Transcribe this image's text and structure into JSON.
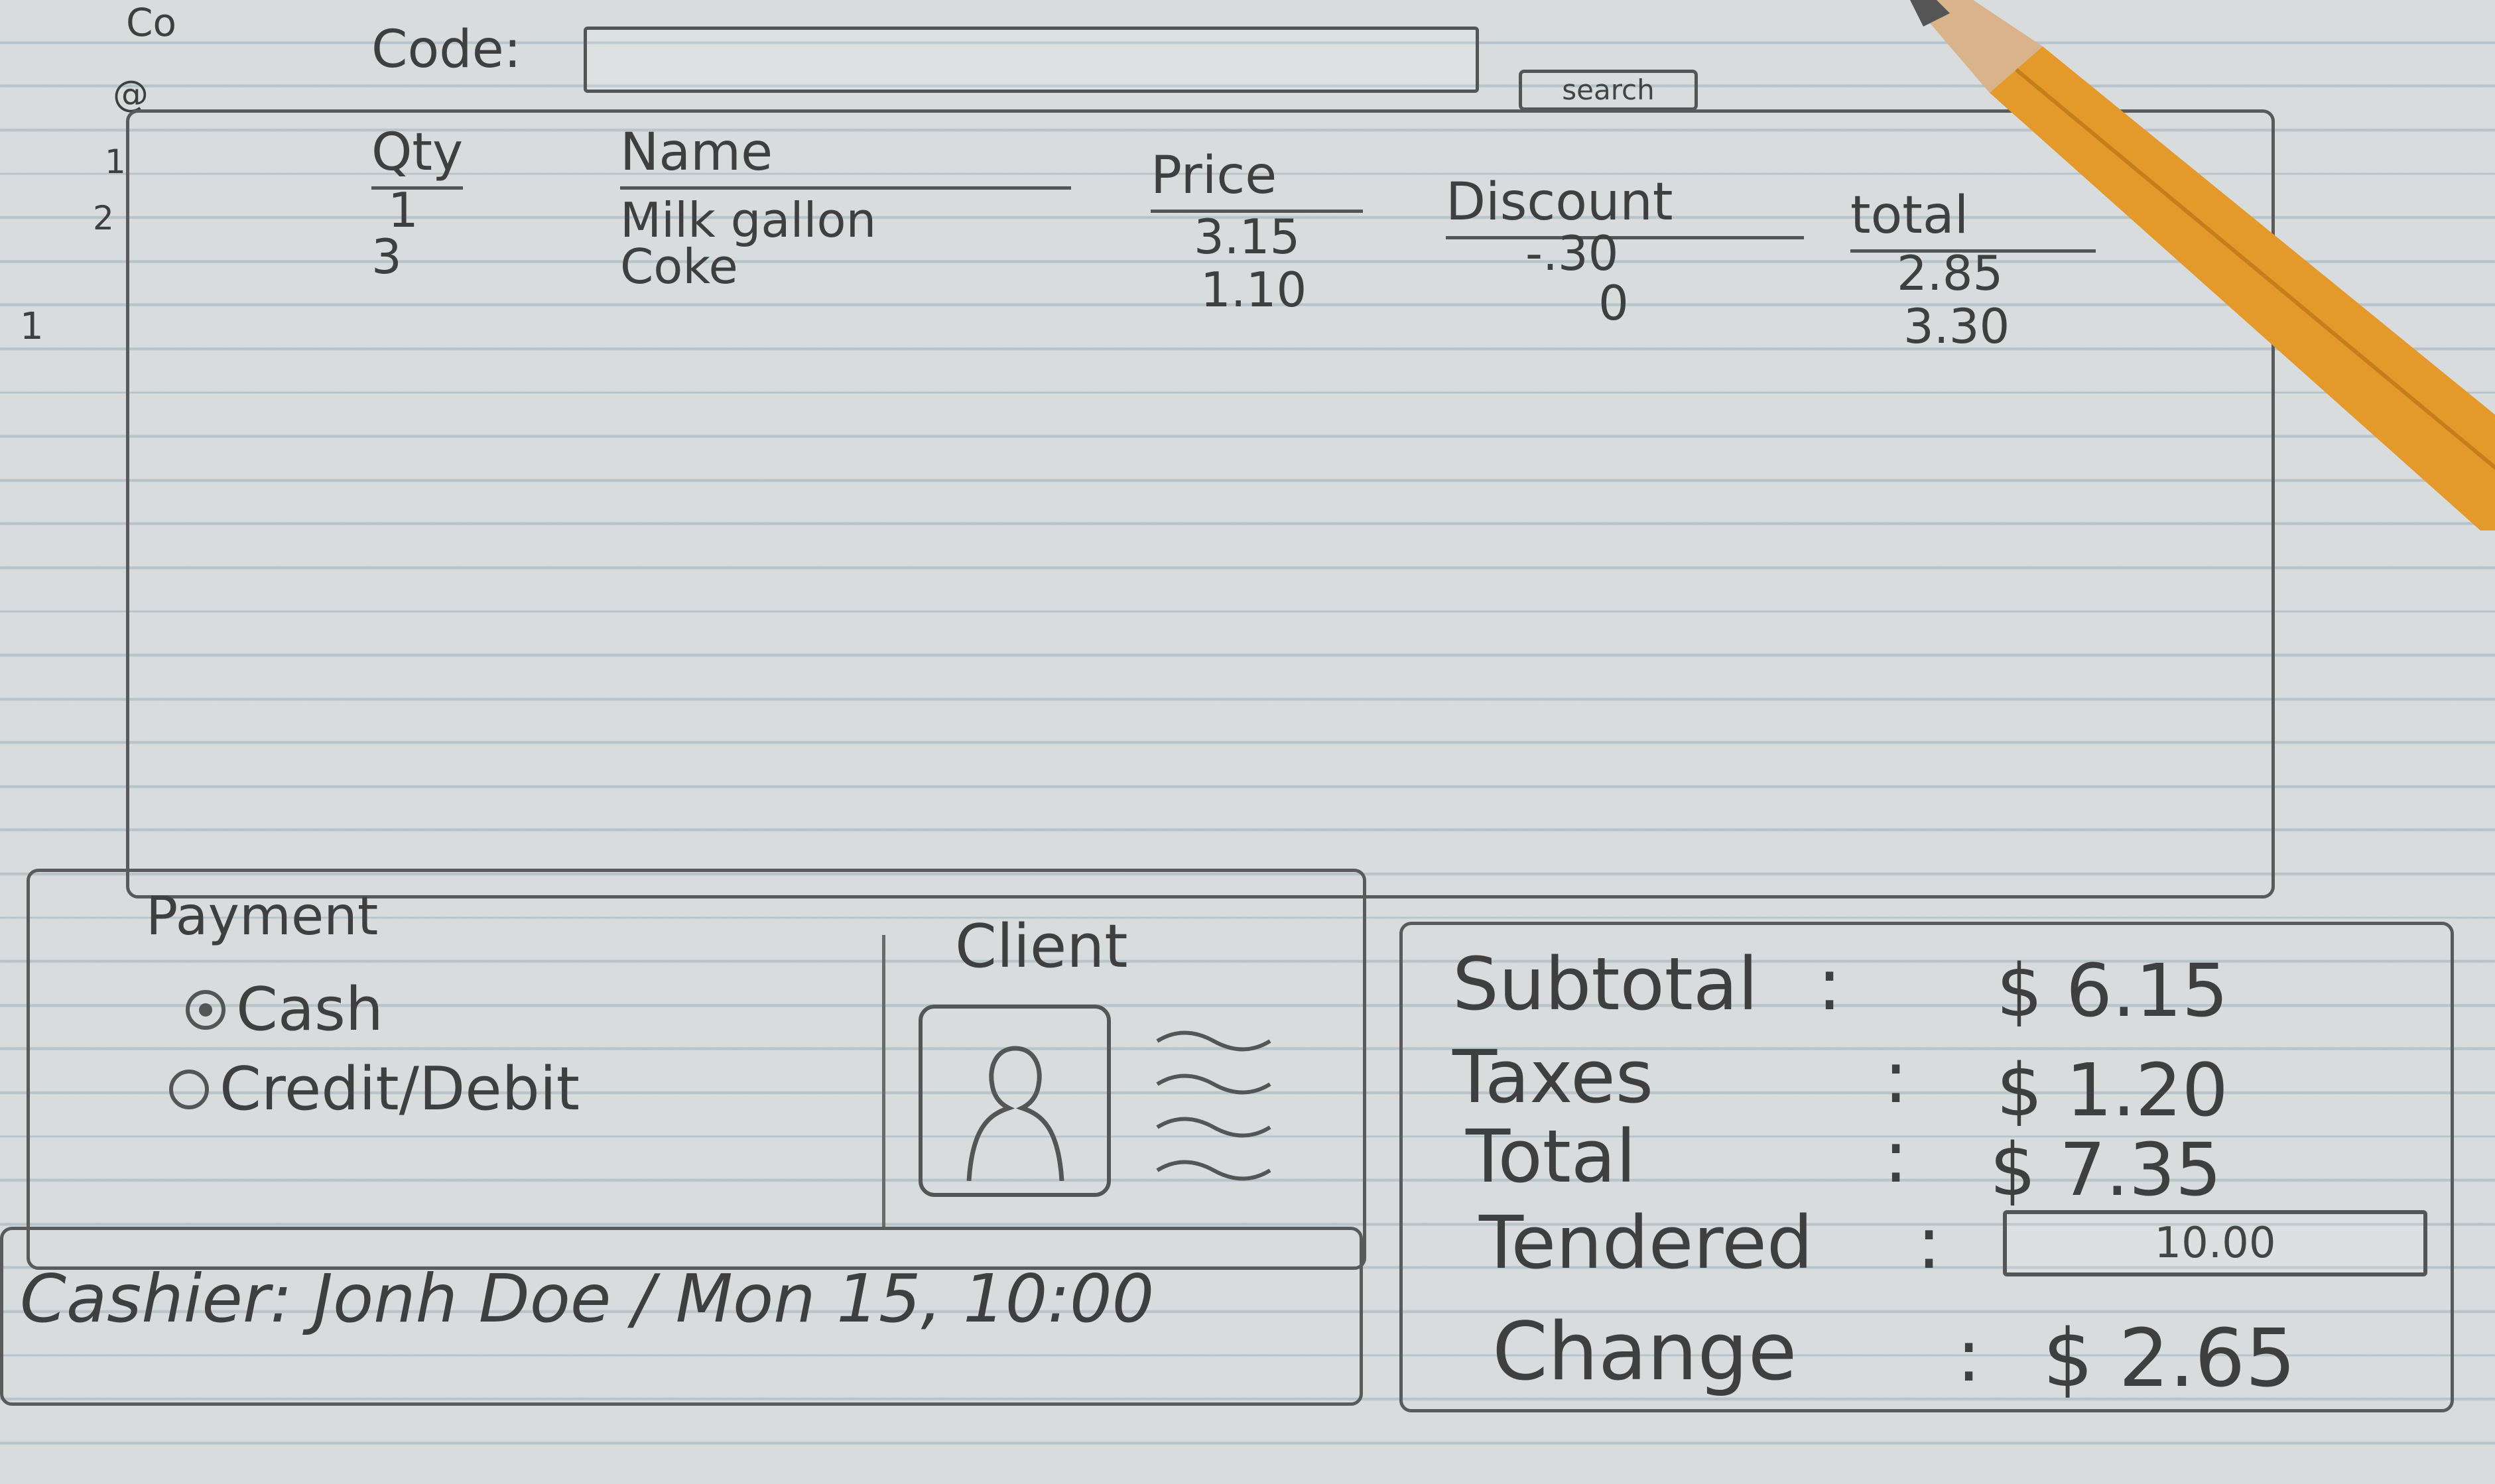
{
  "side_marks": [
    "Co",
    "@",
    "1",
    "2",
    "1"
  ],
  "code": {
    "label": "Code:",
    "value": "",
    "search_label": "search"
  },
  "items": {
    "headers": {
      "qty": "Qty",
      "name": "Name",
      "price": "Price",
      "discount": "Discount",
      "total": "total"
    },
    "rows": [
      {
        "qty": "1",
        "name": "Milk gallon",
        "price": "3.15",
        "discount": "-.30",
        "total": "2.85"
      },
      {
        "qty": "3",
        "name": "Coke",
        "price": "1.10",
        "discount": "0",
        "total": "3.30"
      }
    ]
  },
  "payment": {
    "title": "Payment",
    "options": [
      {
        "label": "Cash",
        "selected": true
      },
      {
        "label": "Credit/Debit",
        "selected": false
      }
    ]
  },
  "client": {
    "label": "Client"
  },
  "cashier": {
    "text": "Cashier: Jonh Doe / Mon 15, 10:00"
  },
  "totals": {
    "subtotal_label": "Subtotal",
    "subtotal_value": "$ 6.15",
    "taxes_label": "Taxes",
    "taxes_value": "$ 1.20",
    "total_label": "Total",
    "total_value": "$ 7.35",
    "tendered_label": "Tendered",
    "tendered_value": "10.00",
    "change_label": "Change",
    "change_value": "$ 2.65",
    "separator": ":"
  },
  "colors": {
    "pencil_body": "#e39a2b",
    "pencil_wood": "#d9b48a",
    "graphite": "#555555"
  }
}
